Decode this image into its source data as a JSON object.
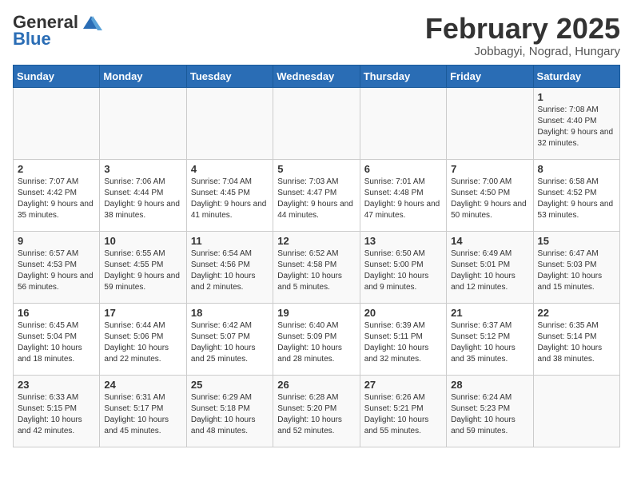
{
  "logo": {
    "general": "General",
    "blue": "Blue"
  },
  "header": {
    "month": "February 2025",
    "location": "Jobbagyi, Nograd, Hungary"
  },
  "days_of_week": [
    "Sunday",
    "Monday",
    "Tuesday",
    "Wednesday",
    "Thursday",
    "Friday",
    "Saturday"
  ],
  "weeks": [
    [
      {
        "day": "",
        "info": ""
      },
      {
        "day": "",
        "info": ""
      },
      {
        "day": "",
        "info": ""
      },
      {
        "day": "",
        "info": ""
      },
      {
        "day": "",
        "info": ""
      },
      {
        "day": "",
        "info": ""
      },
      {
        "day": "1",
        "info": "Sunrise: 7:08 AM\nSunset: 4:40 PM\nDaylight: 9 hours and 32 minutes."
      }
    ],
    [
      {
        "day": "2",
        "info": "Sunrise: 7:07 AM\nSunset: 4:42 PM\nDaylight: 9 hours and 35 minutes."
      },
      {
        "day": "3",
        "info": "Sunrise: 7:06 AM\nSunset: 4:44 PM\nDaylight: 9 hours and 38 minutes."
      },
      {
        "day": "4",
        "info": "Sunrise: 7:04 AM\nSunset: 4:45 PM\nDaylight: 9 hours and 41 minutes."
      },
      {
        "day": "5",
        "info": "Sunrise: 7:03 AM\nSunset: 4:47 PM\nDaylight: 9 hours and 44 minutes."
      },
      {
        "day": "6",
        "info": "Sunrise: 7:01 AM\nSunset: 4:48 PM\nDaylight: 9 hours and 47 minutes."
      },
      {
        "day": "7",
        "info": "Sunrise: 7:00 AM\nSunset: 4:50 PM\nDaylight: 9 hours and 50 minutes."
      },
      {
        "day": "8",
        "info": "Sunrise: 6:58 AM\nSunset: 4:52 PM\nDaylight: 9 hours and 53 minutes."
      }
    ],
    [
      {
        "day": "9",
        "info": "Sunrise: 6:57 AM\nSunset: 4:53 PM\nDaylight: 9 hours and 56 minutes."
      },
      {
        "day": "10",
        "info": "Sunrise: 6:55 AM\nSunset: 4:55 PM\nDaylight: 9 hours and 59 minutes."
      },
      {
        "day": "11",
        "info": "Sunrise: 6:54 AM\nSunset: 4:56 PM\nDaylight: 10 hours and 2 minutes."
      },
      {
        "day": "12",
        "info": "Sunrise: 6:52 AM\nSunset: 4:58 PM\nDaylight: 10 hours and 5 minutes."
      },
      {
        "day": "13",
        "info": "Sunrise: 6:50 AM\nSunset: 5:00 PM\nDaylight: 10 hours and 9 minutes."
      },
      {
        "day": "14",
        "info": "Sunrise: 6:49 AM\nSunset: 5:01 PM\nDaylight: 10 hours and 12 minutes."
      },
      {
        "day": "15",
        "info": "Sunrise: 6:47 AM\nSunset: 5:03 PM\nDaylight: 10 hours and 15 minutes."
      }
    ],
    [
      {
        "day": "16",
        "info": "Sunrise: 6:45 AM\nSunset: 5:04 PM\nDaylight: 10 hours and 18 minutes."
      },
      {
        "day": "17",
        "info": "Sunrise: 6:44 AM\nSunset: 5:06 PM\nDaylight: 10 hours and 22 minutes."
      },
      {
        "day": "18",
        "info": "Sunrise: 6:42 AM\nSunset: 5:07 PM\nDaylight: 10 hours and 25 minutes."
      },
      {
        "day": "19",
        "info": "Sunrise: 6:40 AM\nSunset: 5:09 PM\nDaylight: 10 hours and 28 minutes."
      },
      {
        "day": "20",
        "info": "Sunrise: 6:39 AM\nSunset: 5:11 PM\nDaylight: 10 hours and 32 minutes."
      },
      {
        "day": "21",
        "info": "Sunrise: 6:37 AM\nSunset: 5:12 PM\nDaylight: 10 hours and 35 minutes."
      },
      {
        "day": "22",
        "info": "Sunrise: 6:35 AM\nSunset: 5:14 PM\nDaylight: 10 hours and 38 minutes."
      }
    ],
    [
      {
        "day": "23",
        "info": "Sunrise: 6:33 AM\nSunset: 5:15 PM\nDaylight: 10 hours and 42 minutes."
      },
      {
        "day": "24",
        "info": "Sunrise: 6:31 AM\nSunset: 5:17 PM\nDaylight: 10 hours and 45 minutes."
      },
      {
        "day": "25",
        "info": "Sunrise: 6:29 AM\nSunset: 5:18 PM\nDaylight: 10 hours and 48 minutes."
      },
      {
        "day": "26",
        "info": "Sunrise: 6:28 AM\nSunset: 5:20 PM\nDaylight: 10 hours and 52 minutes."
      },
      {
        "day": "27",
        "info": "Sunrise: 6:26 AM\nSunset: 5:21 PM\nDaylight: 10 hours and 55 minutes."
      },
      {
        "day": "28",
        "info": "Sunrise: 6:24 AM\nSunset: 5:23 PM\nDaylight: 10 hours and 59 minutes."
      },
      {
        "day": "",
        "info": ""
      }
    ]
  ]
}
